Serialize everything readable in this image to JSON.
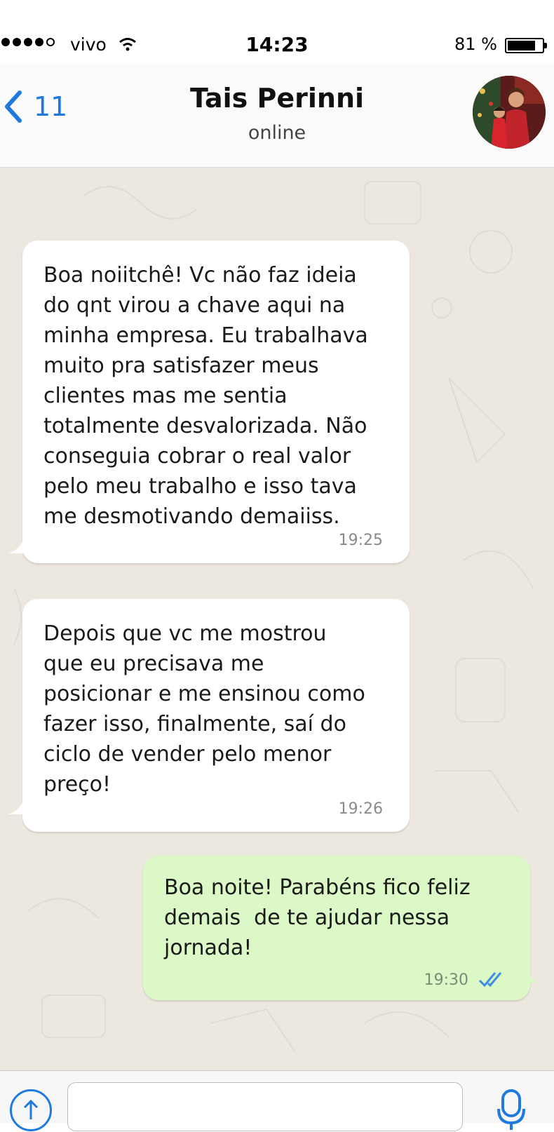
{
  "status_bar": {
    "carrier": "vivo",
    "time": "14:23",
    "battery_pct": "81 %",
    "battery_level": 0.81
  },
  "header": {
    "back_count": "11",
    "contact_name": "Tais Perinni",
    "contact_status": "online"
  },
  "messages": [
    {
      "direction": "incoming",
      "text": "Boa noiitchê! Vc não faz ideia\ndo qnt virou a chave aqui na\nminha empresa. Eu trabalhava\nmuito pra satisfazer meus\nclientes mas me sentia\ntotalmente desvalorizada. Não\nconseguia cobrar o real valor\npelo meu trabalho e isso tava\nme desmotivando demaiiss.",
      "time": "19:25"
    },
    {
      "direction": "incoming",
      "text": "Depois que vc me mostrou\nque eu precisava me\nposicionar e me ensinou como\nfazer isso, finalmente, saí do\nciclo de vender pelo menor\npreço!",
      "time": "19:26"
    },
    {
      "direction": "outgoing",
      "text": "Boa noite! Parabéns fico feliz\ndemais  de te ajudar nessa\njornada!",
      "time": "19:30",
      "read": true
    }
  ],
  "input_bar": {
    "placeholder": ""
  },
  "colors": {
    "accent": "#1f7ae0",
    "outgoing_bubble": "#dcf8c6",
    "incoming_bubble": "#ffffff",
    "chat_background": "#ece7df",
    "read_ticks": "#3b8fe0"
  },
  "icons": [
    "back-chevron-icon",
    "wifi-icon",
    "battery-icon",
    "upload-icon",
    "microphone-icon",
    "double-check-icon"
  ]
}
